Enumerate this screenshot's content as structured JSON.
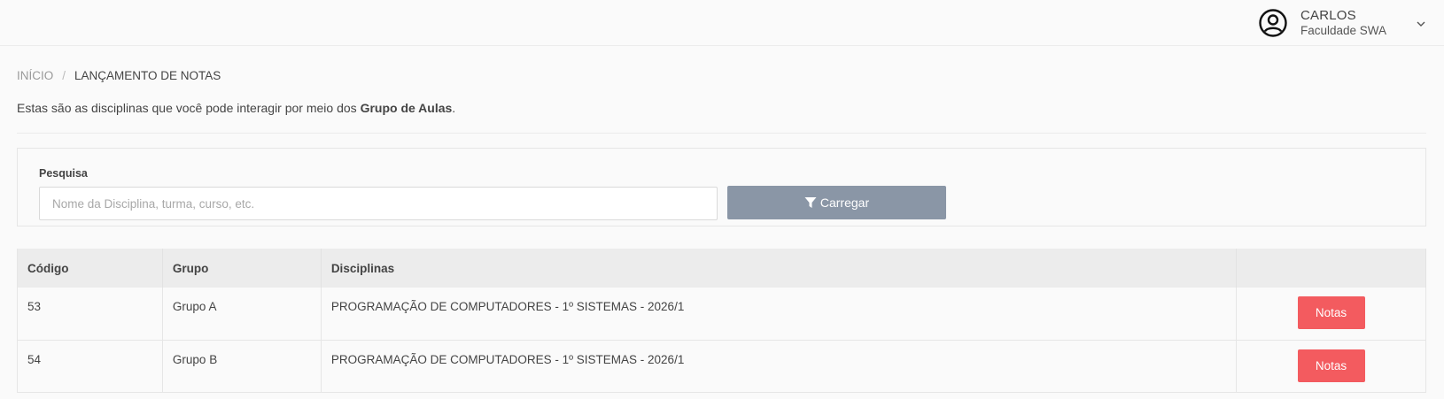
{
  "user": {
    "name": "CARLOS",
    "organization": "Faculdade SWA"
  },
  "breadcrumb": {
    "home": "INÍCIO",
    "separator": "/",
    "current": "LANÇAMENTO DE NOTAS"
  },
  "intro": {
    "text_before": "Estas são as disciplinas que você pode interagir por meio dos ",
    "bold": "Grupo de Aulas",
    "text_after": "."
  },
  "filter": {
    "label": "Pesquisa",
    "search_value": "",
    "search_placeholder": "Nome da Disciplina, turma, curso, etc.",
    "load_button_label": "Carregar"
  },
  "table": {
    "headers": [
      "Código",
      "Grupo",
      "Disciplinas",
      ""
    ],
    "rows": [
      {
        "codigo": "53",
        "grupo": "Grupo A",
        "disciplina": "PROGRAMAÇÃO DE COMPUTADORES - 1º SISTEMAS - 2026/1",
        "action": "Notas"
      },
      {
        "codigo": "54",
        "grupo": "Grupo B",
        "disciplina": "PROGRAMAÇÃO DE COMPUTADORES - 1º SISTEMAS - 2026/1",
        "action": "Notas"
      }
    ]
  },
  "colors": {
    "accent_button": "#f35b5f",
    "load_button": "#8a96a6"
  },
  "icons": {
    "user": "user-circle-icon",
    "dropdown": "chevron-down-icon",
    "filter": "filter-icon"
  }
}
